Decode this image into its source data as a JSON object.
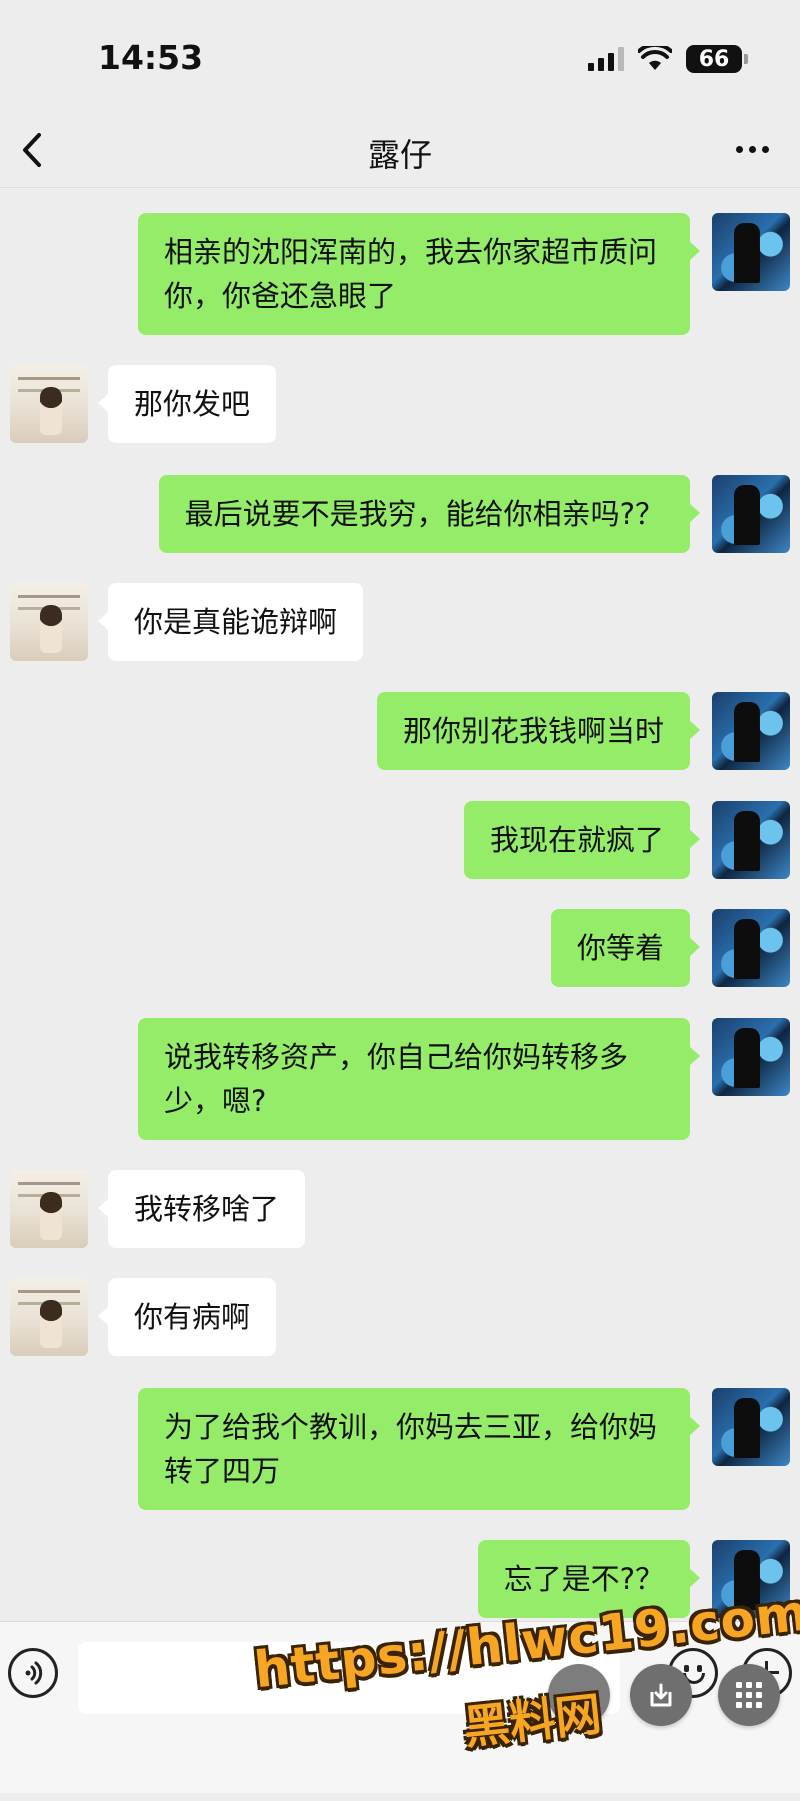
{
  "status_bar": {
    "time": "14:53",
    "battery": "66",
    "icons": [
      "signal-icon",
      "wifi-icon",
      "battery-icon"
    ]
  },
  "header": {
    "title": "露仔",
    "back_icon": "chevron-left-icon",
    "more_icon": "more-dots-icon"
  },
  "messages": [
    {
      "from": "me",
      "text": "相亲的沈阳浑南的，我去你家超市质问你，你爸还急眼了"
    },
    {
      "from": "her",
      "text": "那你发吧"
    },
    {
      "from": "me",
      "text": "最后说要不是我穷，能给你相亲吗?？"
    },
    {
      "from": "her",
      "text": "你是真能诡辩啊"
    },
    {
      "from": "me",
      "text": "那你别花我钱啊当时"
    },
    {
      "from": "me",
      "text": "我现在就疯了"
    },
    {
      "from": "me",
      "text": "你等着"
    },
    {
      "from": "me",
      "text": "说我转移资产，你自己给你妈转移多少，嗯?"
    },
    {
      "from": "her",
      "text": "我转移啥了"
    },
    {
      "from": "her",
      "text": "你有病啊"
    },
    {
      "from": "me",
      "text": "为了给我个教训，你妈去三亚，给你妈转了四万"
    },
    {
      "from": "me",
      "text": "忘了是不?？"
    }
  ],
  "input_bar": {
    "voice_icon": "voice-icon",
    "input_value": "",
    "emoji_icon": "emoji-icon",
    "plus_icon": "plus-icon"
  },
  "watermark": {
    "url": "https://hlwc19.com",
    "site": "黑料网"
  },
  "colors": {
    "background": "#ededed",
    "my_bubble": "#95ec69",
    "her_bubble": "#ffffff",
    "watermark": "#f6a623"
  }
}
